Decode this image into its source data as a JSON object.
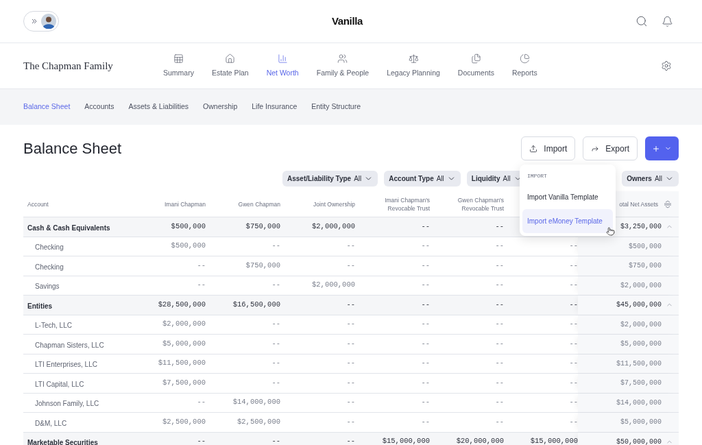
{
  "brand": "Vanilla",
  "family": "The Chapman Family",
  "sidebar_collapsed": true,
  "nav": [
    {
      "label": "Summary",
      "selected": false
    },
    {
      "label": "Estate Plan",
      "selected": false
    },
    {
      "label": "Net Worth",
      "selected": true
    },
    {
      "label": "Family & People",
      "selected": false
    },
    {
      "label": "Legacy Planning",
      "selected": false
    },
    {
      "label": "Documents",
      "selected": false
    },
    {
      "label": "Reports",
      "selected": false
    }
  ],
  "subnav": [
    {
      "label": "Balance Sheet",
      "selected": true
    },
    {
      "label": "Accounts",
      "selected": false
    },
    {
      "label": "Assets & Liabilities",
      "selected": false
    },
    {
      "label": "Ownership",
      "selected": false
    },
    {
      "label": "Life Insurance",
      "selected": false
    },
    {
      "label": "Entity Structure",
      "selected": false
    }
  ],
  "title": "Balance Sheet",
  "actions": {
    "import": "Import",
    "export": "Export"
  },
  "filters_left": [
    {
      "label": "Asset/Liability Type",
      "value": "All"
    },
    {
      "label": "Account Type",
      "value": "All"
    },
    {
      "label": "Liquidity",
      "value": "All"
    }
  ],
  "filters_right": [
    {
      "label": "Owners",
      "value": "All"
    }
  ],
  "import_menu": {
    "heading": "IMPORT",
    "items": [
      {
        "label": "Import Vanilla Template",
        "selected": false
      },
      {
        "label": "Import eMoney Template",
        "selected": true
      }
    ]
  },
  "table": {
    "columns": [
      "Account",
      "Imani Chapman",
      "Gwen Chapman",
      "Joint Ownership",
      "Imani Chapman's Revocable Trust",
      "Gwen Chapman's Revocable Trust",
      "otal Net Assets"
    ],
    "rows": [
      {
        "kind": "group",
        "account": "Cash & Cash Equivalents",
        "values": [
          "$500,000",
          "$750,000",
          "$2,000,000",
          "--",
          "--"
        ],
        "total": "$3,250,000",
        "expanded": true
      },
      {
        "kind": "item",
        "account": "Checking",
        "values": [
          "$500,000",
          "--",
          "--",
          "--",
          "--",
          "--"
        ],
        "total": "$500,000"
      },
      {
        "kind": "item",
        "account": "Checking",
        "values": [
          "--",
          "$750,000",
          "--",
          "--",
          "--",
          "--"
        ],
        "total": "$750,000"
      },
      {
        "kind": "item",
        "account": "Savings",
        "values": [
          "--",
          "--",
          "$2,000,000",
          "--",
          "--",
          "--"
        ],
        "total": "$2,000,000"
      },
      {
        "kind": "group",
        "account": "Entities",
        "values": [
          "$28,500,000",
          "$16,500,000",
          "--",
          "--",
          "--",
          "--"
        ],
        "total": "$45,000,000",
        "expanded": true
      },
      {
        "kind": "item",
        "account": "L-Tech, LLC",
        "values": [
          "$2,000,000",
          "--",
          "--",
          "--",
          "--",
          "--"
        ],
        "total": "$2,000,000"
      },
      {
        "kind": "item",
        "account": "Chapman Sisters, LLC",
        "values": [
          "$5,000,000",
          "--",
          "--",
          "--",
          "--",
          "--"
        ],
        "total": "$5,000,000"
      },
      {
        "kind": "item",
        "account": "LTI Enterprises, LLC",
        "values": [
          "$11,500,000",
          "--",
          "--",
          "--",
          "--",
          "--"
        ],
        "total": "$11,500,000"
      },
      {
        "kind": "item",
        "account": "LTI Capital, LLC",
        "values": [
          "$7,500,000",
          "--",
          "--",
          "--",
          "--",
          "--"
        ],
        "total": "$7,500,000"
      },
      {
        "kind": "item",
        "account": "Johnson Family, LLC",
        "values": [
          "--",
          "$14,000,000",
          "--",
          "--",
          "--",
          "--"
        ],
        "total": "$14,000,000"
      },
      {
        "kind": "item",
        "account": "D&M, LLC",
        "values": [
          "$2,500,000",
          "$2,500,000",
          "--",
          "--",
          "--",
          "--"
        ],
        "total": "$5,000,000"
      },
      {
        "kind": "group",
        "account": "Marketable Securities",
        "values": [
          "--",
          "--",
          "--",
          "$15,000,000",
          "$20,000,000",
          "$15,000,000"
        ],
        "total": "$50,000,000",
        "expanded": true
      }
    ]
  }
}
